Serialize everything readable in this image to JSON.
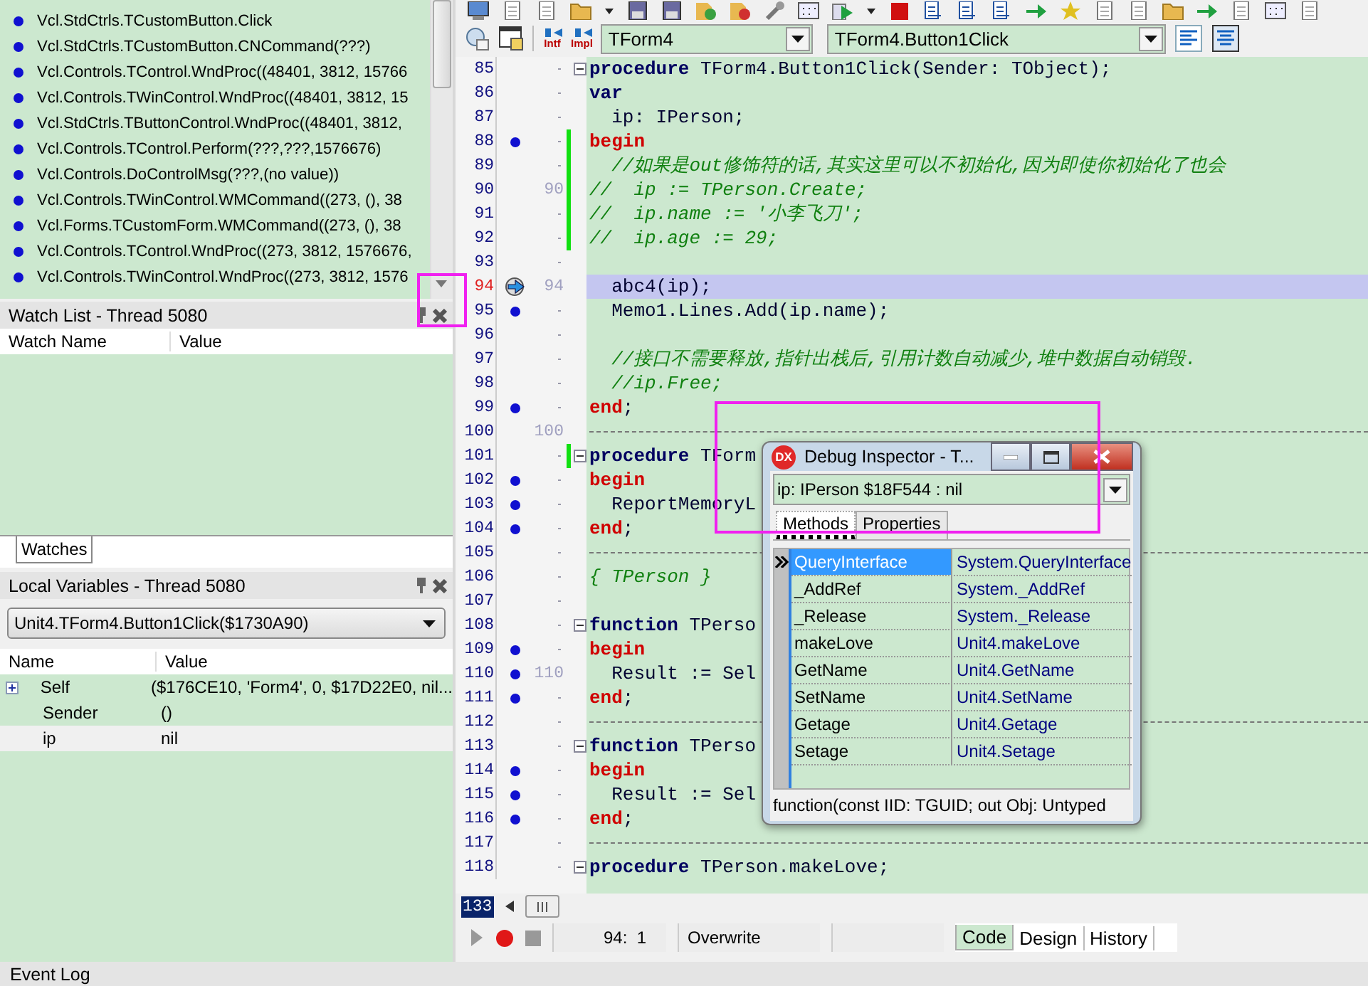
{
  "call_stack": {
    "items": [
      "Vcl.StdCtrls.TCustomButton.Click",
      "Vcl.StdCtrls.TCustomButton.CNCommand(???)",
      "Vcl.Controls.TControl.WndProc((48401, 3812, 15766",
      "Vcl.Controls.TWinControl.WndProc((48401, 3812, 15",
      "Vcl.StdCtrls.TButtonControl.WndProc((48401, 3812,",
      "Vcl.Controls.TControl.Perform(???,???,1576676)",
      "Vcl.Controls.DoControlMsg(???,(no value))",
      "Vcl.Controls.TWinControl.WMCommand((273, (), 38",
      "Vcl.Forms.TCustomForm.WMCommand((273, (), 38",
      "Vcl.Controls.TControl.WndProc((273, 3812, 1576676,",
      "Vcl.Controls.TWinControl.WndProc((273, 3812, 1576"
    ]
  },
  "watch_list": {
    "title": "Watch List - Thread 5080",
    "columns": [
      "Watch Name",
      "Value"
    ]
  },
  "watch_tabs": [
    {
      "label": "Watches",
      "selected": true
    }
  ],
  "local_variables": {
    "title": "Local Variables - Thread 5080",
    "frame": "Unit4.TForm4.Button1Click($1730A90)",
    "columns": [
      "Name",
      "Value"
    ],
    "rows": [
      {
        "name": "Self",
        "value": "($176CE10, 'Form4', 0, $17D22E0, nil...",
        "expanded": false,
        "selected": false
      },
      {
        "name": "Sender",
        "value": "()",
        "selected": false
      },
      {
        "name": "ip",
        "value": "nil",
        "selected": true
      }
    ]
  },
  "editor": {
    "intf_label": "Intf",
    "impl_label": "Impl",
    "class_combo": "TForm4",
    "method_combo": "TForm4.Button1Click",
    "line_indicator": "133",
    "lines": [
      {
        "num": "85",
        "kind": "code",
        "fold": true,
        "parts": [
          {
            "kind": "keyword",
            "text": "procedure"
          },
          {
            "kind": "plain",
            "text": " TForm4.Button1Click(Sender: TObject);"
          }
        ]
      },
      {
        "num": "86",
        "kind": "code",
        "parts": [
          {
            "kind": "keyword",
            "text": "var"
          }
        ]
      },
      {
        "num": "87",
        "kind": "code",
        "parts": [
          {
            "kind": "plain",
            "text": "  ip: IPerson;"
          }
        ]
      },
      {
        "num": "88",
        "kind": "code",
        "breakpoint": true,
        "modified": true,
        "parts": [
          {
            "kind": "block",
            "text": "begin"
          }
        ]
      },
      {
        "num": "89",
        "kind": "code",
        "modified": true,
        "parts": [
          {
            "kind": "comment",
            "text": "  //如果是out修饰符的话,其实这里可以不初始化,因为即使你初始化了也会"
          }
        ]
      },
      {
        "num": "90",
        "kind": "code",
        "alt": "90",
        "modified": true,
        "parts": [
          {
            "kind": "comment",
            "text": "//  ip := TPerson.Create;"
          }
        ]
      },
      {
        "num": "91",
        "kind": "code",
        "modified": true,
        "parts": [
          {
            "kind": "comment",
            "text": "//  ip.name := '小李飞刀';"
          }
        ]
      },
      {
        "num": "92",
        "kind": "code",
        "modified": true,
        "parts": [
          {
            "kind": "comment",
            "text": "//  ip.age := 29;"
          }
        ]
      },
      {
        "num": "93",
        "kind": "code"
      },
      {
        "num": "94",
        "kind": "code",
        "execution_point": true,
        "alt": "94",
        "current": true,
        "parts": [
          {
            "kind": "plain",
            "text": "  abc4(ip);"
          }
        ]
      },
      {
        "num": "95",
        "kind": "code",
        "breakpoint": true,
        "parts": [
          {
            "kind": "plain",
            "text": "  Memo1.Lines.Add(ip.name);"
          }
        ]
      },
      {
        "num": "96",
        "kind": "code"
      },
      {
        "num": "97",
        "kind": "code",
        "parts": [
          {
            "kind": "comment",
            "text": "  //接口不需要释放,指针出栈后,引用计数自动减少,堆中数据自动销毁."
          }
        ]
      },
      {
        "num": "98",
        "kind": "code",
        "parts": [
          {
            "kind": "comment",
            "text": "  //ip.Free;"
          }
        ]
      },
      {
        "num": "99",
        "kind": "code",
        "breakpoint": true,
        "parts": [
          {
            "kind": "block",
            "text": "end"
          },
          {
            "kind": "plain",
            "text": ";"
          }
        ]
      },
      {
        "num": "100",
        "kind": "separator",
        "alt": "100"
      },
      {
        "num": "101",
        "kind": "code",
        "fold": true,
        "modified": true,
        "parts": [
          {
            "kind": "keyword",
            "text": "procedure"
          },
          {
            "kind": "plain",
            "text": " TForm"
          }
        ]
      },
      {
        "num": "102",
        "kind": "code",
        "breakpoint": true,
        "parts": [
          {
            "kind": "block",
            "text": "begin"
          }
        ]
      },
      {
        "num": "103",
        "kind": "code",
        "breakpoint": true,
        "parts": [
          {
            "kind": "plain",
            "text": "  ReportMemoryL"
          }
        ]
      },
      {
        "num": "104",
        "kind": "code",
        "breakpoint": true,
        "parts": [
          {
            "kind": "block",
            "text": "end"
          },
          {
            "kind": "plain",
            "text": ";"
          }
        ]
      },
      {
        "num": "105",
        "kind": "separator"
      },
      {
        "num": "106",
        "kind": "code",
        "parts": [
          {
            "kind": "comment",
            "text": "{ TPerson }"
          }
        ]
      },
      {
        "num": "107",
        "kind": "code"
      },
      {
        "num": "108",
        "kind": "code",
        "fold": true,
        "parts": [
          {
            "kind": "keyword",
            "text": "function"
          },
          {
            "kind": "plain",
            "text": " TPerso"
          }
        ]
      },
      {
        "num": "109",
        "kind": "code",
        "breakpoint": true,
        "parts": [
          {
            "kind": "block",
            "text": "begin"
          }
        ]
      },
      {
        "num": "110",
        "kind": "code",
        "breakpoint": true,
        "alt": "110",
        "parts": [
          {
            "kind": "plain",
            "text": "  Result := Sel"
          }
        ]
      },
      {
        "num": "111",
        "kind": "code",
        "breakpoint": true,
        "parts": [
          {
            "kind": "block",
            "text": "end"
          },
          {
            "kind": "plain",
            "text": ";"
          }
        ]
      },
      {
        "num": "112",
        "kind": "separator"
      },
      {
        "num": "113",
        "kind": "code",
        "fold": true,
        "parts": [
          {
            "kind": "keyword",
            "text": "function"
          },
          {
            "kind": "plain",
            "text": " TPerso"
          }
        ]
      },
      {
        "num": "114",
        "kind": "code",
        "breakpoint": true,
        "parts": [
          {
            "kind": "block",
            "text": "begin"
          }
        ]
      },
      {
        "num": "115",
        "kind": "code",
        "breakpoint": true,
        "parts": [
          {
            "kind": "plain",
            "text": "  Result := Sel"
          }
        ]
      },
      {
        "num": "116",
        "kind": "code",
        "breakpoint": true,
        "parts": [
          {
            "kind": "block",
            "text": "end"
          },
          {
            "kind": "plain",
            "text": ";"
          }
        ]
      },
      {
        "num": "117",
        "kind": "separator"
      },
      {
        "num": "118",
        "kind": "code",
        "fold": true,
        "parts": [
          {
            "kind": "keyword",
            "text": "procedure"
          },
          {
            "kind": "plain",
            "text": " TPerson.makeLove;"
          }
        ]
      }
    ]
  },
  "status_bar": {
    "position": "94:  1",
    "mode": "Overwrite",
    "tabs": [
      {
        "label": "Code",
        "selected": true
      },
      {
        "label": "Design",
        "selected": false
      },
      {
        "label": "History",
        "selected": false
      }
    ]
  },
  "debug_inspector": {
    "logo": "DX",
    "title": "Debug Inspector - T...",
    "expression": "ip: IPerson $18F544 : nil",
    "tabs": [
      {
        "label": "Methods",
        "selected": true
      },
      {
        "label": "Properties",
        "selected": false
      }
    ],
    "rows": [
      {
        "name": "QueryInterface",
        "value": "System.QueryInterface",
        "selected": true
      },
      {
        "name": "_AddRef",
        "value": "System._AddRef",
        "selected": false
      },
      {
        "name": "_Release",
        "value": "System._Release",
        "selected": false
      },
      {
        "name": "makeLove",
        "value": "Unit4.makeLove",
        "selected": false
      },
      {
        "name": "GetName",
        "value": "Unit4.GetName",
        "selected": false
      },
      {
        "name": "SetName",
        "value": "Unit4.SetName",
        "selected": false
      },
      {
        "name": "Getage",
        "value": "Unit4.Getage",
        "selected": false
      },
      {
        "name": "Setage",
        "value": "Unit4.Setage",
        "selected": false
      }
    ],
    "footer": "function(const IID: TGUID; out Obj: Untyped"
  },
  "event_log": {
    "title": "Event Log"
  }
}
